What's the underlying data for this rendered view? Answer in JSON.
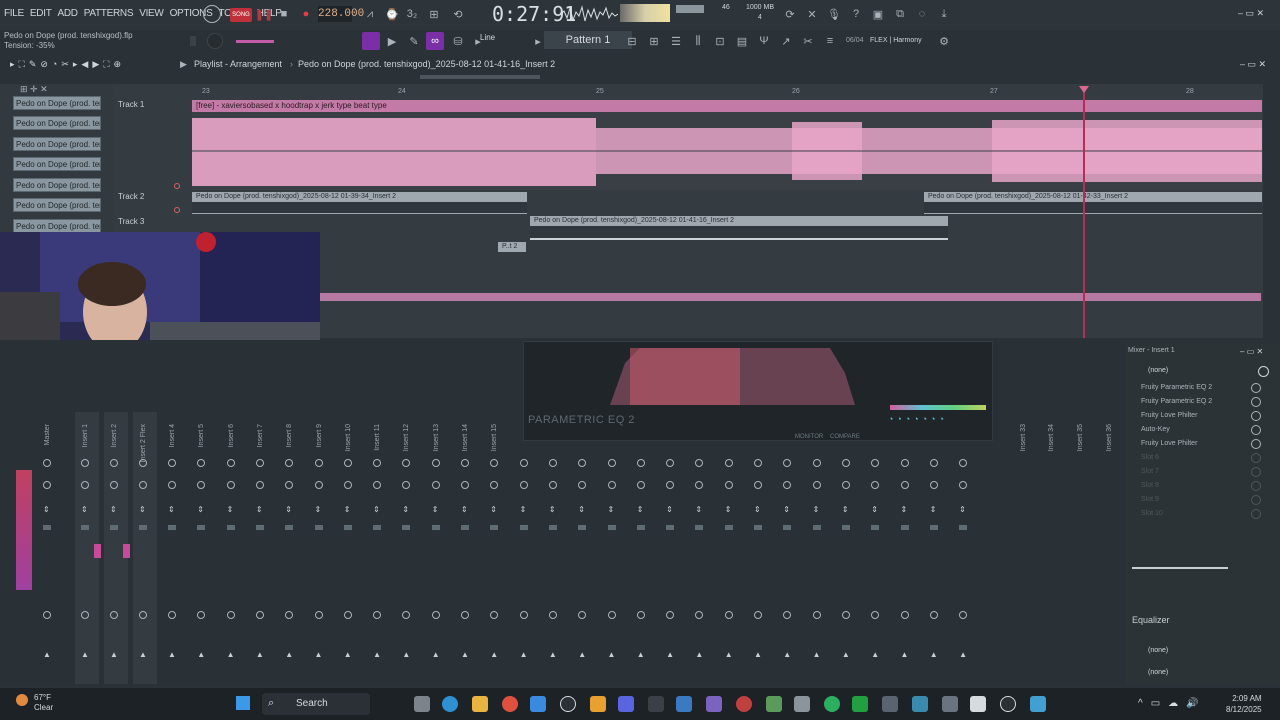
{
  "menu": [
    "FILE",
    "EDIT",
    "ADD",
    "PATTERNS",
    "VIEW",
    "OPTIONS",
    "TOOLS",
    "HELP"
  ],
  "transport": {
    "song_label": "SONG",
    "tempo": "228.000",
    "time": "0:27:91",
    "cpu": "46",
    "mem": "1000 MB",
    "voices": "4"
  },
  "hint": {
    "file": "Pedo on Dope (prod. tenshixgod).flp",
    "tension": "Tension: -35%"
  },
  "toolbar": {
    "line": "Line",
    "pattern": "Pattern 1",
    "flex_num": "06/04",
    "flex_preset": "FLEX | Harmony"
  },
  "playlist": {
    "title": "Playlist - Arrangement",
    "breadcrumb": "Pedo on Dope (prod. tenshixgod)_2025-08-12 01-41-16_Insert 2",
    "picker_items": [
      "Pedo on Dope (prod. tens..",
      "Pedo on Dope (prod. tens..",
      "Pedo on Dope (prod. tens..",
      "Pedo on Dope (prod. tens..",
      "Pedo on Dope (prod. tens..",
      "Pedo on Dope (prod. tens..",
      "Pedo on Dope (prod. tens..",
      "Pedo on Dope (prod. tens.."
    ],
    "tracks": [
      "Track 1",
      "Track 2",
      "Track 3"
    ],
    "ruler": [
      "23",
      "24",
      "25",
      "26",
      "27",
      "28"
    ],
    "clip_main": "[free] - xaviersobased x hoodtrap x jerk type beat type",
    "clip_t2a": "Pedo on Dope (prod. tenshixgod)_2025-08-12 01-39-34_Insert 2",
    "clip_t2b": "Pedo on Dope (prod. tenshixgod)_2025-08-12 01-42-33_Insert 2",
    "clip_t3": "Pedo on Dope (prod. tenshixgod)_2025-08-12 01-41-16_Insert 2",
    "clip_small": "P..t 2"
  },
  "mixer": {
    "title": "Mixer - Insert 1",
    "channels": [
      "Master",
      "Insert 1",
      "Insert 2",
      "Insert 2 Flex",
      "Insert 4",
      "Insert 5",
      "Insert 6",
      "Insert 7",
      "Insert 8",
      "Insert 9",
      "Insert 10",
      "Insert 11",
      "Insert 12",
      "Insert 13",
      "Insert 14",
      "Insert 15"
    ],
    "right_channels": [
      "Insert 33",
      "Insert 34",
      "Insert 35",
      "Insert 36"
    ],
    "eq_label": "PARAMETRIC EQ 2",
    "eq_buttons": [
      "MONITOR",
      "COMPARE"
    ],
    "input": "(none)",
    "slots": [
      "Fruity Parametric EQ 2",
      "Fruity Parametric EQ 2",
      "Fruity Love Philter",
      "Auto-Key",
      "Fruity Love Philter",
      "Slot 6",
      "Slot 7",
      "Slot 8",
      "Slot 9",
      "Slot 10"
    ],
    "equalizer": "Equalizer",
    "output1": "(none)",
    "output2": "(none)"
  },
  "taskbar": {
    "weather_temp": "67°F",
    "weather_desc": "Clear",
    "search": "Search",
    "time": "2:09 AM",
    "date": "8/12/2025"
  },
  "colors": {
    "accent": "#e8a4c8",
    "playhead": "#b03058",
    "clip": "#9ea8ae"
  }
}
